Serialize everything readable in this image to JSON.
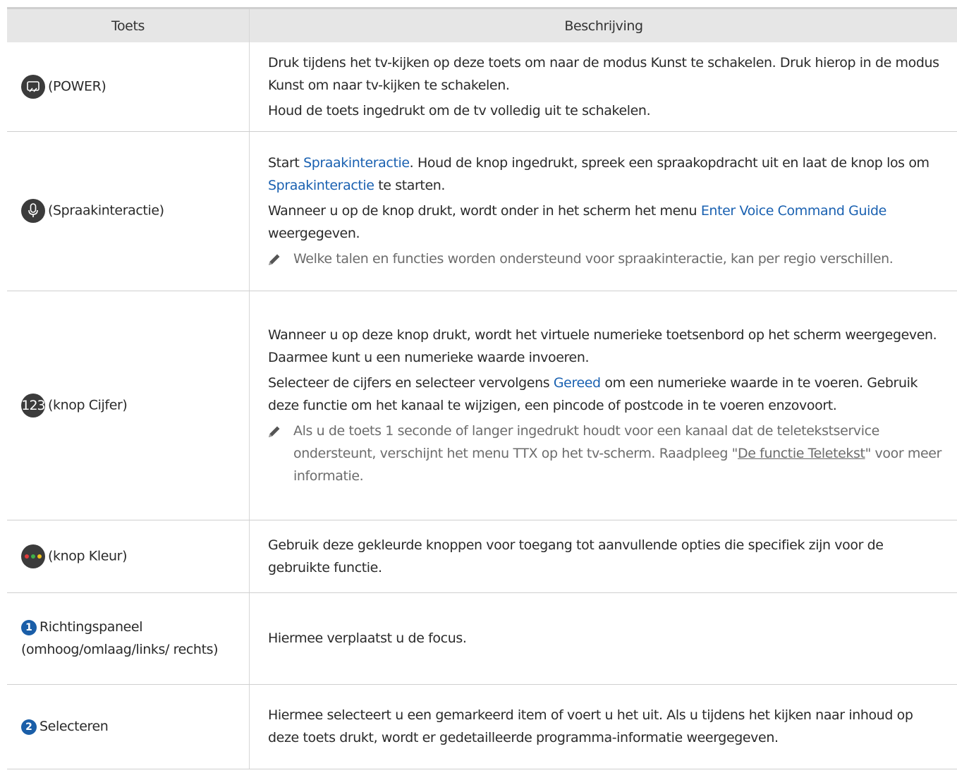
{
  "header": {
    "col_key": "Toets",
    "col_desc": "Beschrijving"
  },
  "icons": {
    "power": "power-icon",
    "voice": "microphone-icon",
    "number": "123",
    "color": "color-dots-icon",
    "badge1": "1",
    "badge2": "2",
    "note": "pencil-icon"
  },
  "colors": {
    "link": "#1a61b1",
    "red": "#e23b3b",
    "green": "#3fb04a",
    "yellow": "#f2c21b",
    "badge": "#1a5ea8"
  },
  "rows": [
    {
      "key": "(POWER)",
      "p1": "Druk tijdens het tv-kijken op deze toets om naar de modus Kunst te schakelen. Druk hierop in de modus Kunst om naar tv-kijken te schakelen.",
      "p2": "Houd de toets ingedrukt om de tv volledig uit te schakelen."
    },
    {
      "key": "(Spraakinteractie)",
      "p1_a": "Start ",
      "p1_link": "Spraakinteractie",
      "p1_b": ". Houd de knop ingedrukt, spreek een spraakopdracht uit en laat de knop los om ",
      "p1_link2": "Spraakinteractie",
      "p1_c": " te starten.",
      "p2_a": "Wanneer u op de knop drukt, wordt onder in het scherm het menu ",
      "p2_link": "Enter Voice Command Guide",
      "p2_b": " weergegeven.",
      "note": "Welke talen en functies worden ondersteund voor spraakinteractie, kan per regio verschillen."
    },
    {
      "key": "(knop Cijfer)",
      "p1": "Wanneer u op deze knop drukt, wordt het virtuele numerieke toetsenbord op het scherm weergegeven. Daarmee kunt u een numerieke waarde invoeren.",
      "p2_a": "Selecteer de cijfers en selecteer vervolgens ",
      "p2_link": "Gereed",
      "p2_b": " om een numerieke waarde in te voeren. Gebruik deze functie om het kanaal te wijzigen, een pincode of postcode in te voeren enzovoort.",
      "note_a": "Als u de toets 1 seconde of langer ingedrukt houdt voor een kanaal dat de teletekstservice ondersteunt, verschijnt het menu TTX op het tv-scherm. Raadpleeg \"",
      "note_link": "De functie Teletekst",
      "note_b": "\" voor meer informatie."
    },
    {
      "key": "(knop Kleur)",
      "p1": "Gebruik deze gekleurde knoppen voor toegang tot aanvullende opties die specifiek zijn voor de gebruikte functie."
    },
    {
      "key": "Richtingspaneel (omhoog/omlaag/links/ rechts)",
      "p1": "Hiermee verplaatst u de focus."
    },
    {
      "key": "Selecteren",
      "p1": "Hiermee selecteert u een gemarkeerd item of voert u het uit. Als u tijdens het kijken naar inhoud op deze toets drukt, wordt er gedetailleerde programma-informatie weergegeven."
    }
  ]
}
